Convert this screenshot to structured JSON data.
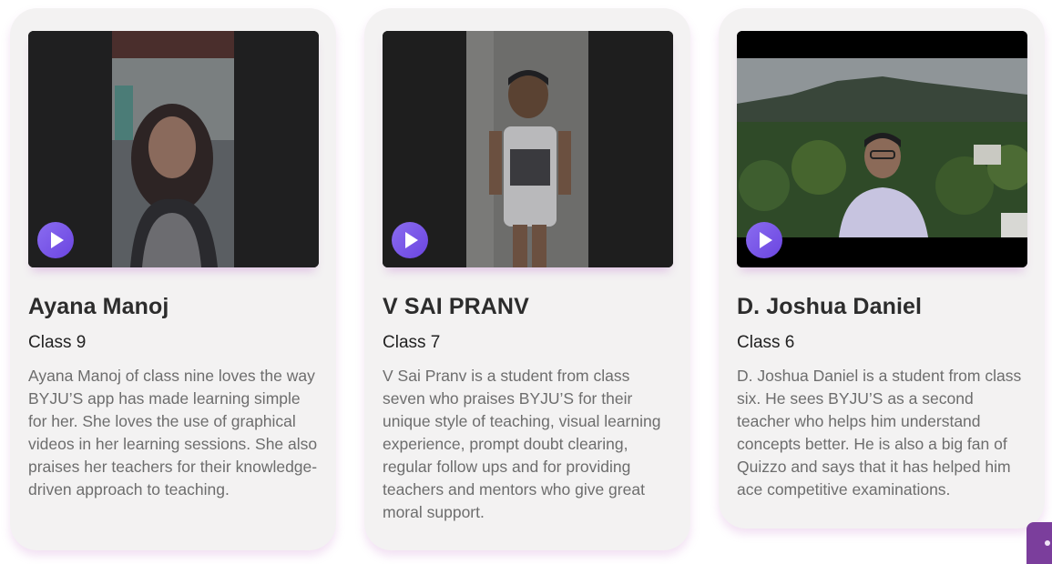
{
  "testimonials": [
    {
      "name": "Ayana Manoj",
      "class": "Class 9",
      "description": "Ayana Manoj of class nine loves the way BYJU’S app has made learning simple for her. She loves the use of graphical videos in her learning sessions. She also praises her teachers for their knowledge-driven approach to teaching.",
      "video_icon": "play-icon"
    },
    {
      "name": "V SAI PRANV",
      "class": "Class 7",
      "description": "V Sai Pranv is a student from class seven who praises BYJU’S for their unique style of teaching, visual learning experience, prompt doubt clearing, regular follow ups and for providing teachers and mentors who give great moral support.",
      "video_icon": "play-icon"
    },
    {
      "name": "D. Joshua Daniel",
      "class": "Class 6",
      "description": "D. Joshua Daniel is a student from class six. He sees BYJU’S as a second teacher who helps him understand concepts better. He is also a big fan of Quizzo and says that it has helped him ace competitive examinations.",
      "video_icon": "play-icon"
    }
  ],
  "colors": {
    "card_background": "#f3f2f2",
    "play_button": "#7a56e8",
    "name_text": "#2c2c2c",
    "description_text": "#6d6d6d",
    "chat_tab": "#7b3e9c"
  }
}
